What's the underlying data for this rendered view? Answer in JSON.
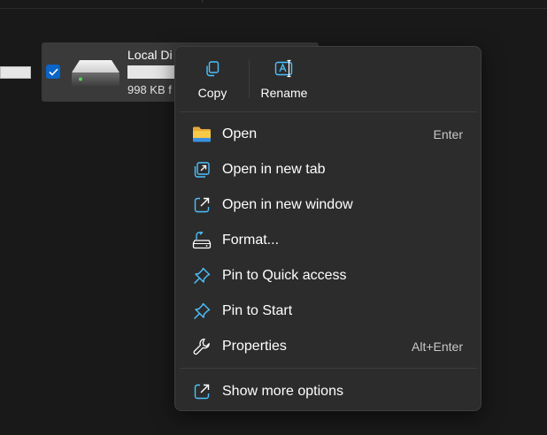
{
  "drive": {
    "name": "Local Di",
    "free_text": "998 KB f",
    "selected": true
  },
  "menu": {
    "quick_actions": [
      {
        "label": "Copy",
        "icon": "copy-icon"
      },
      {
        "label": "Rename",
        "icon": "rename-icon"
      }
    ],
    "items": [
      {
        "label": "Open",
        "shortcut": "Enter",
        "icon": "folder-icon"
      },
      {
        "label": "Open in new tab",
        "shortcut": "",
        "icon": "open-new-tab-icon"
      },
      {
        "label": "Open in new window",
        "shortcut": "",
        "icon": "open-new-window-icon"
      },
      {
        "label": "Format...",
        "shortcut": "",
        "icon": "format-drive-icon"
      },
      {
        "label": "Pin to Quick access",
        "shortcut": "",
        "icon": "pin-icon"
      },
      {
        "label": "Pin to Start",
        "shortcut": "",
        "icon": "pin-icon"
      },
      {
        "label": "Properties",
        "shortcut": "Alt+Enter",
        "icon": "wrench-icon"
      }
    ],
    "more": {
      "label": "Show more options",
      "icon": "show-more-icon"
    }
  },
  "colors": {
    "background": "#191919",
    "menu_background": "#2c2c2c",
    "accent_blue": "#4cc2ff",
    "checkbox_blue": "#0a64c9",
    "folder_yellow": "#f2c94c"
  }
}
